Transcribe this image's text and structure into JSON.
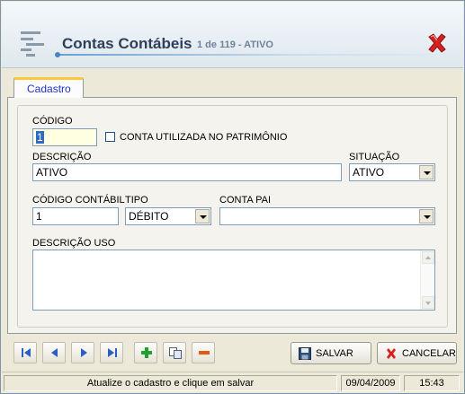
{
  "window": {
    "title": "Contas Contábeis",
    "subtitle": "1 de 119 - ATIVO"
  },
  "tabs": [
    {
      "label": "Cadastro",
      "active": true
    }
  ],
  "form": {
    "codigo": {
      "label": "CÓDIGO",
      "value": "1"
    },
    "patrimonio": {
      "label": "CONTA UTILIZADA NO PATRIMÔNIO",
      "checked": false
    },
    "descricao": {
      "label": "DESCRIÇÃO",
      "value": "ATIVO"
    },
    "situacao": {
      "label": "SITUAÇÃO",
      "value": "ATIVO"
    },
    "codigo_contabil": {
      "label": "CÓDIGO CONTÁBIL",
      "value": "1"
    },
    "tipo": {
      "label": "TIPO",
      "value": "DÉBITO"
    },
    "conta_pai": {
      "label": "CONTA PAI",
      "value": ""
    },
    "descricao_uso": {
      "label": "DESCRIÇÃO USO",
      "value": ""
    }
  },
  "toolbar": {
    "icons": [
      "first-record-icon",
      "previous-record-icon",
      "next-record-icon",
      "last-record-icon",
      "add-icon",
      "copy-icon",
      "remove-icon"
    ],
    "save_label": "SALVAR",
    "cancel_label": "CANCELAR"
  },
  "statusbar": {
    "message": "Atualize o cadastro e clique em salvar",
    "date": "09/04/2009",
    "time": "15:43"
  },
  "colors": {
    "title": "#2d3f5a",
    "subtitle": "#6f8299",
    "tab_label": "#1e34c8",
    "tab_highlight": "#ffc83c",
    "nav_blue": "#2a5fc8",
    "add_green": "#22a030",
    "remove_orange": "#e05a10",
    "close_red": "#d8201c"
  }
}
